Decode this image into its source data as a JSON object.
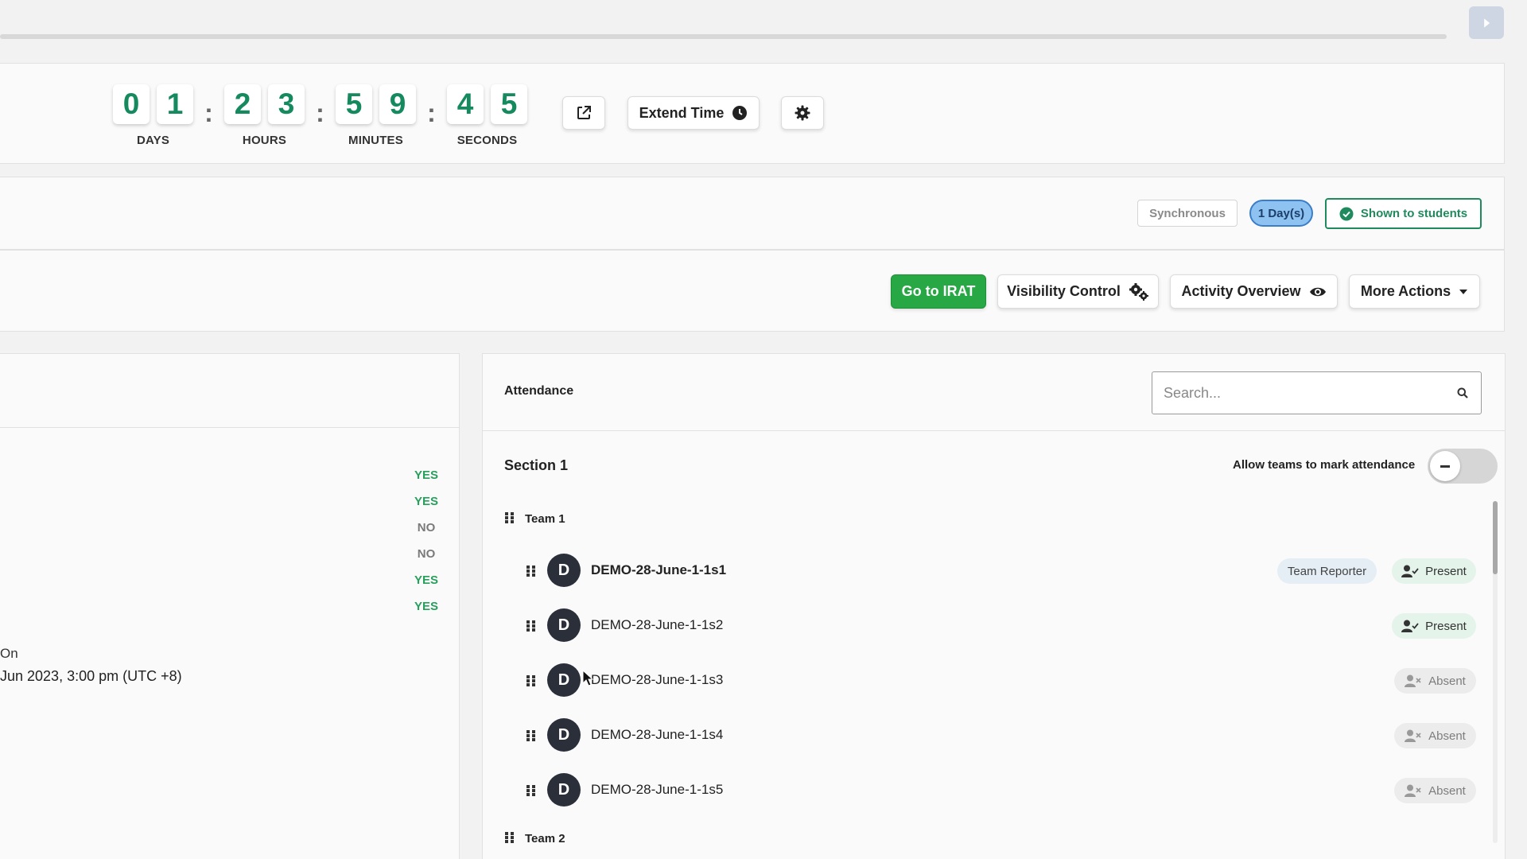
{
  "timer": {
    "days": [
      "0",
      "1"
    ],
    "hours": [
      "2",
      "3"
    ],
    "minutes": [
      "5",
      "9"
    ],
    "seconds": [
      "4",
      "5"
    ],
    "labels": {
      "days": "DAYS",
      "hours": "HOURS",
      "minutes": "MINUTES",
      "seconds": "SECONDS"
    },
    "separator": ":",
    "accent_color": "#168a5f"
  },
  "toolbar": {
    "extend_time_label": "Extend Time",
    "popout_icon": "external-link-icon",
    "settings_icon": "gear-icon"
  },
  "badges": {
    "mode": "Synchronous",
    "duration": "1 Day(s)",
    "visibility": "Shown to students"
  },
  "actions": {
    "go_to_irat": "Go to IRAT",
    "visibility_control": "Visibility Control",
    "activity_overview": "Activity Overview",
    "more_actions": "More Actions",
    "primary_color": "#27a844"
  },
  "left_panel": {
    "values": [
      "YES",
      "YES",
      "NO",
      "NO",
      "YES",
      "YES"
    ],
    "fragment_label": "On",
    "fragment_date": "Jun 2023, 3:00 pm (UTC +8)"
  },
  "attendance": {
    "title": "Attendance",
    "search_placeholder": "Search...",
    "section_title": "Section 1",
    "allow_label": "Allow teams to mark attendance",
    "allow_enabled": false,
    "teams": [
      {
        "name": "Team 1",
        "members": [
          {
            "initial": "D",
            "name": "DEMO-28-June-1-1s1",
            "role": "Team Reporter",
            "status": "Present"
          },
          {
            "initial": "D",
            "name": "DEMO-28-June-1-1s2",
            "role": "",
            "status": "Present"
          },
          {
            "initial": "D",
            "name": "DEMO-28-June-1-1s3",
            "role": "",
            "status": "Absent"
          },
          {
            "initial": "D",
            "name": "DEMO-28-June-1-1s4",
            "role": "",
            "status": "Absent"
          },
          {
            "initial": "D",
            "name": "DEMO-28-June-1-1s5",
            "role": "",
            "status": "Absent"
          }
        ]
      },
      {
        "name": "Team 2",
        "members": []
      }
    ]
  }
}
